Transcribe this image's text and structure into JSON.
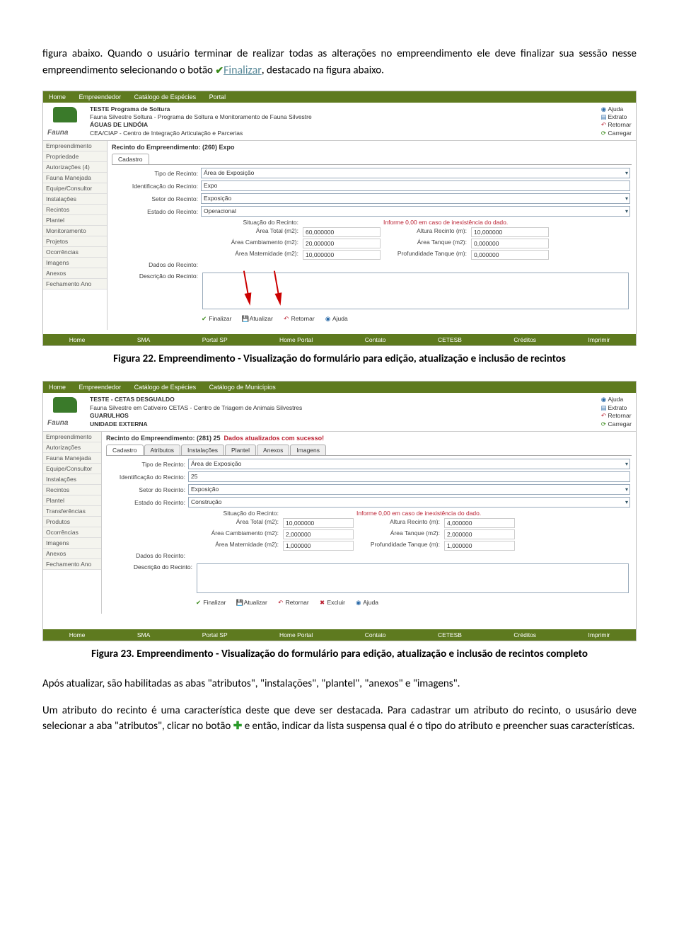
{
  "intro": {
    "p1a": "figura abaixo. Quando o usuário terminar de realizar todas as alterações no empreendimento ele deve finalizar sua sessão nesse empreendimento selecionando o botão ",
    "finalizar": "Finalizar",
    "p1b": ", destacado na figura abaixo."
  },
  "fig22": {
    "topnav": [
      "Home",
      "Empreendedor",
      "Catálogo de Espécies",
      "Portal"
    ],
    "header": {
      "l1": "TESTE Programa de Soltura",
      "l2": "Fauna Silvestre Soltura - Programa de Soltura e Monitoramento de Fauna Silvestre",
      "l3": "ÁGUAS DE LINDÓIA",
      "l4": "CEA/CIAP - Centro de Integração Articulação e Parcerias"
    },
    "logo": "Fauna",
    "links": [
      "Ajuda",
      "Extrato",
      "Retornar",
      "Carregar"
    ],
    "sidebar": [
      "Empreendimento",
      "Propriedade",
      "Autorizações (4)",
      "Fauna Manejada",
      "Equipe/Consultor",
      "Instalações",
      "Recintos",
      "Plantel",
      "Monitoramento",
      "Projetos",
      "Ocorrências",
      "Imagens",
      "Anexos",
      "Fechamento Ano"
    ],
    "title_a": "Recinto do Empreendimento: (260) Expo",
    "tabs": [
      "Cadastro"
    ],
    "form": {
      "tipo_l": "Tipo de Recinto:",
      "tipo_v": "Área de Exposição",
      "ident_l": "Identificação do Recinto:",
      "ident_v": "Expo",
      "setor_l": "Setor do Recinto:",
      "setor_v": "Exposição",
      "estado_l": "Estado do Recinto:",
      "estado_v": "Operacional",
      "dados_l": "Dados do Recinto:",
      "warn": "Informe 0,00 em caso de inexistência do dado.",
      "sit_l": "Situação do Recinto:",
      "at_l": "Área Total (m2):",
      "at_v": "60,000000",
      "ar_l": "Altura Recinto (m):",
      "ar_v": "10,000000",
      "ac_l": "Área Cambiamento (m2):",
      "ac_v": "20,000000",
      "aq_l": "Área Tanque (m2):",
      "aq_v": "0,000000",
      "am_l": "Área Maternidade (m2):",
      "am_v": "10,000000",
      "pt_l": "Profundidade Tanque (m):",
      "pt_v": "0,000000",
      "desc_l": "Descrição do Recinto:"
    },
    "actions": [
      "Finalizar",
      "Atualizar",
      "Retornar",
      "Ajuda"
    ],
    "footer": [
      "Home",
      "SMA",
      "Portal SP",
      "Home Portal",
      "Contato",
      "CETESB",
      "Créditos",
      "Imprimir"
    ],
    "caption": "Figura 22. Empreendimento - Visualização do formulário para edição, atualização e inclusão de recintos"
  },
  "fig23": {
    "topnav": [
      "Home",
      "Empreendedor",
      "Catálogo de Espécies",
      "Catálogo de Municípios"
    ],
    "header": {
      "l1": "TESTE - CETAS DESGUALDO",
      "l2": "Fauna Silvestre em Cativeiro CETAS - Centro de Triagem de Animais Silvestres",
      "l3": "GUARULHOS",
      "l4": "UNIDADE EXTERNA"
    },
    "logo": "Fauna",
    "links": [
      "Ajuda",
      "Extrato",
      "Retornar",
      "Carregar"
    ],
    "sidebar": [
      "Empreendimento",
      "Autorizações",
      "Fauna Manejada",
      "Equipe/Consultor",
      "Instalações",
      "Recintos",
      "Plantel",
      "Transferências",
      "Produtos",
      "Ocorrências",
      "Imagens",
      "Anexos",
      "Fechamento Ano"
    ],
    "title_a": "Recinto do Empreendimento: (281) 25",
    "success": "Dados atualizados com sucesso!",
    "tabs": [
      "Cadastro",
      "Atributos",
      "Instalações",
      "Plantel",
      "Anexos",
      "Imagens"
    ],
    "form": {
      "tipo_l": "Tipo de Recinto:",
      "tipo_v": "Área de Exposição",
      "ident_l": "Identificação do Recinto:",
      "ident_v": "25",
      "setor_l": "Setor do Recinto:",
      "setor_v": "Exposição",
      "estado_l": "Estado do Recinto:",
      "estado_v": "Construção",
      "dados_l": "Dados do Recinto:",
      "warn": "Informe 0,00 em caso de inexistência do dado.",
      "sit_l": "Situação do Recinto:",
      "at_l": "Área Total (m2):",
      "at_v": "10,000000",
      "ar_l": "Altura Recinto (m):",
      "ar_v": "4,000000",
      "ac_l": "Área Cambiamento (m2):",
      "ac_v": "2,000000",
      "aq_l": "Área Tanque (m2):",
      "aq_v": "2,000000",
      "am_l": "Área Maternidade (m2):",
      "am_v": "1,000000",
      "pt_l": "Profundidade Tanque (m):",
      "pt_v": "1,000000",
      "desc_l": "Descrição do Recinto:"
    },
    "actions": [
      "Finalizar",
      "Atualizar",
      "Retornar",
      "Excluir",
      "Ajuda"
    ],
    "footer": [
      "Home",
      "SMA",
      "Portal SP",
      "Home Portal",
      "Contato",
      "CETESB",
      "Créditos",
      "Imprimir"
    ],
    "caption": "Figura 23. Empreendimento - Visualização do formulário para edição, atualização e inclusão de recintos completo"
  },
  "outro": {
    "p2": "Após atualizar, são habilitadas as abas \"atributos\", \"instalações\", \"plantel\", \"anexos\" e \"imagens\".",
    "p3a": "Um atributo do recinto é uma característica deste que deve ser destacada. Para cadastrar um atributo do recinto, o ususário deve selecionar a aba \"atributos\", clicar no botão ",
    "p3b": " e então, indicar da lista suspensa qual é o tipo do atributo e preencher suas características."
  }
}
